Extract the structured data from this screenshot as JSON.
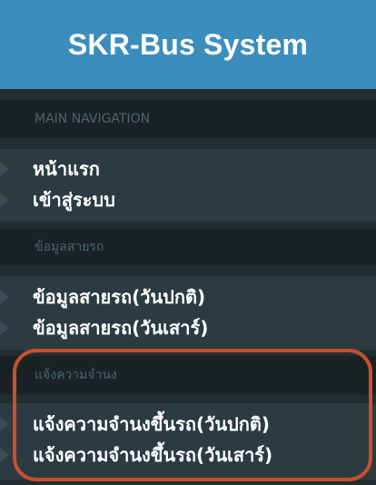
{
  "app": {
    "title": "SKR-Bus System"
  },
  "sidebar": {
    "sections": [
      {
        "header": "MAIN NAVIGATION",
        "items": [
          {
            "label": "หน้าแรก"
          },
          {
            "label": "เข้าสู่ระบบ"
          }
        ]
      },
      {
        "header": "ข้อมูลสายรถ",
        "items": [
          {
            "label": "ข้อมูลสายรถ(วันปกติ)"
          },
          {
            "label": "ข้อมูลสายรถ(วันเสาร์)"
          }
        ]
      },
      {
        "header": "แจ้งความจำนง",
        "items": [
          {
            "label": "แจ้งความจำนงขึ้นรถ(วันปกติ)"
          },
          {
            "label": "แจ้งความจำนงขึ้นรถ(วันเสาร์)"
          }
        ]
      }
    ]
  },
  "colors": {
    "brand": "#3c8dbc",
    "sidebar_bg": "#222d32",
    "header_bg": "#1a2226",
    "highlight": "#c7502d"
  }
}
